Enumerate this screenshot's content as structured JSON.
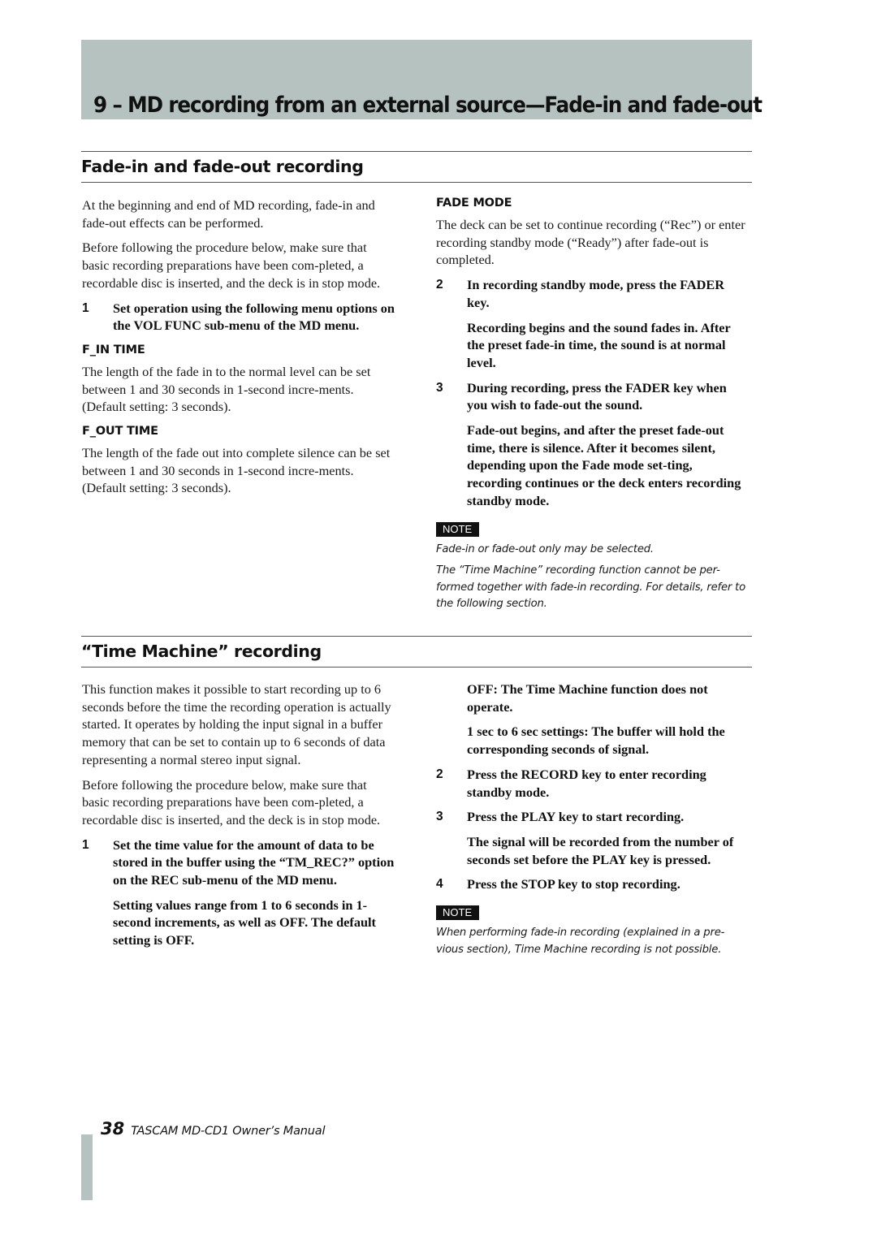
{
  "chapter": {
    "title": "9 – MD recording from an external source—Fade-in and fade-out",
    "accent_color": "#b5c2bf"
  },
  "section1": {
    "heading": "Fade-in and fade-out recording",
    "left": {
      "intro": "At the beginning and end of MD recording, fade-in and fade-out effects can be performed.",
      "prep": "Before following the procedure below, make sure that basic recording preparations have been com-pleted, a recordable disc is inserted, and the deck is in stop mode.",
      "step1": {
        "num": "1",
        "text": "Set operation using the following menu options on the VOL FUNC sub-menu of the MD menu."
      },
      "fin_heading": "F_IN TIME",
      "fin_text": "The length of the fade in to the normal level can be set between 1 and 30 seconds in 1-second incre-ments. (Default setting: 3 seconds).",
      "fout_heading": "F_OUT TIME",
      "fout_text": "The length of the fade out into complete silence can be set between 1 and 30 seconds in 1-second incre-ments. (Default setting: 3 seconds)."
    },
    "right": {
      "mode_heading": "FADE MODE",
      "mode_text": "The deck can be set to continue recording (“Rec”) or enter recording standby mode (“Ready”) after fade-out is completed.",
      "step2": {
        "num": "2",
        "text": "In recording standby mode, press the FADER key."
      },
      "step2_detail": "Recording begins and the sound fades in. After the preset fade-in time, the sound is at normal level.",
      "step3": {
        "num": "3",
        "text": "During recording, press the FADER key when you wish to fade-out the sound."
      },
      "step3_detail": "Fade-out begins, and after the preset fade-out time, there is silence. After it becomes silent, depending upon the Fade mode set-ting, recording continues or the deck enters recording standby mode.",
      "note_label": "NOTE",
      "note_lines": [
        "Fade-in or fade-out only may be selected.",
        "The “Time Machine” recording function cannot be per-formed together with fade-in recording. For details, refer to the following section."
      ]
    }
  },
  "section2": {
    "heading": "“Time Machine” recording",
    "left": {
      "intro": "This function makes it possible to start recording up to 6 seconds before the time the recording operation is actually started. It operates by holding the input signal in a buffer memory that can be set to contain up to 6 seconds of data representing a normal stereo input signal.",
      "prep": "Before following the procedure below, make sure that basic recording preparations have been com-pleted, a recordable disc is inserted, and the deck is in stop mode.",
      "step1": {
        "num": "1",
        "text": "Set the time value for the amount of data to be stored in the buffer using the “TM_REC?” option on the REC sub-menu of the MD menu."
      },
      "step1_detail": "Setting values range from 1 to 6 seconds in 1-second increments, as well as OFF. The default setting is OFF."
    },
    "right": {
      "off_detail": "OFF: The Time Machine function does not operate.",
      "sec_detail": "1 sec to 6 sec settings: The buffer will hold the corresponding seconds of signal.",
      "step2": {
        "num": "2",
        "text": "Press the RECORD key to enter recording standby mode."
      },
      "step3": {
        "num": "3",
        "text": "Press the PLAY key to start recording."
      },
      "step3_detail": "The signal will be recorded from the number of seconds set before the PLAY key is pressed.",
      "step4": {
        "num": "4",
        "text": "Press the STOP key to stop recording."
      },
      "note_label": "NOTE",
      "note_lines": [
        "When performing fade-in recording (explained in a pre-vious section), Time Machine recording is not possible."
      ]
    }
  },
  "footer": {
    "page_number": "38",
    "manual_title": "TASCAM MD-CD1 Owner’s Manual"
  }
}
